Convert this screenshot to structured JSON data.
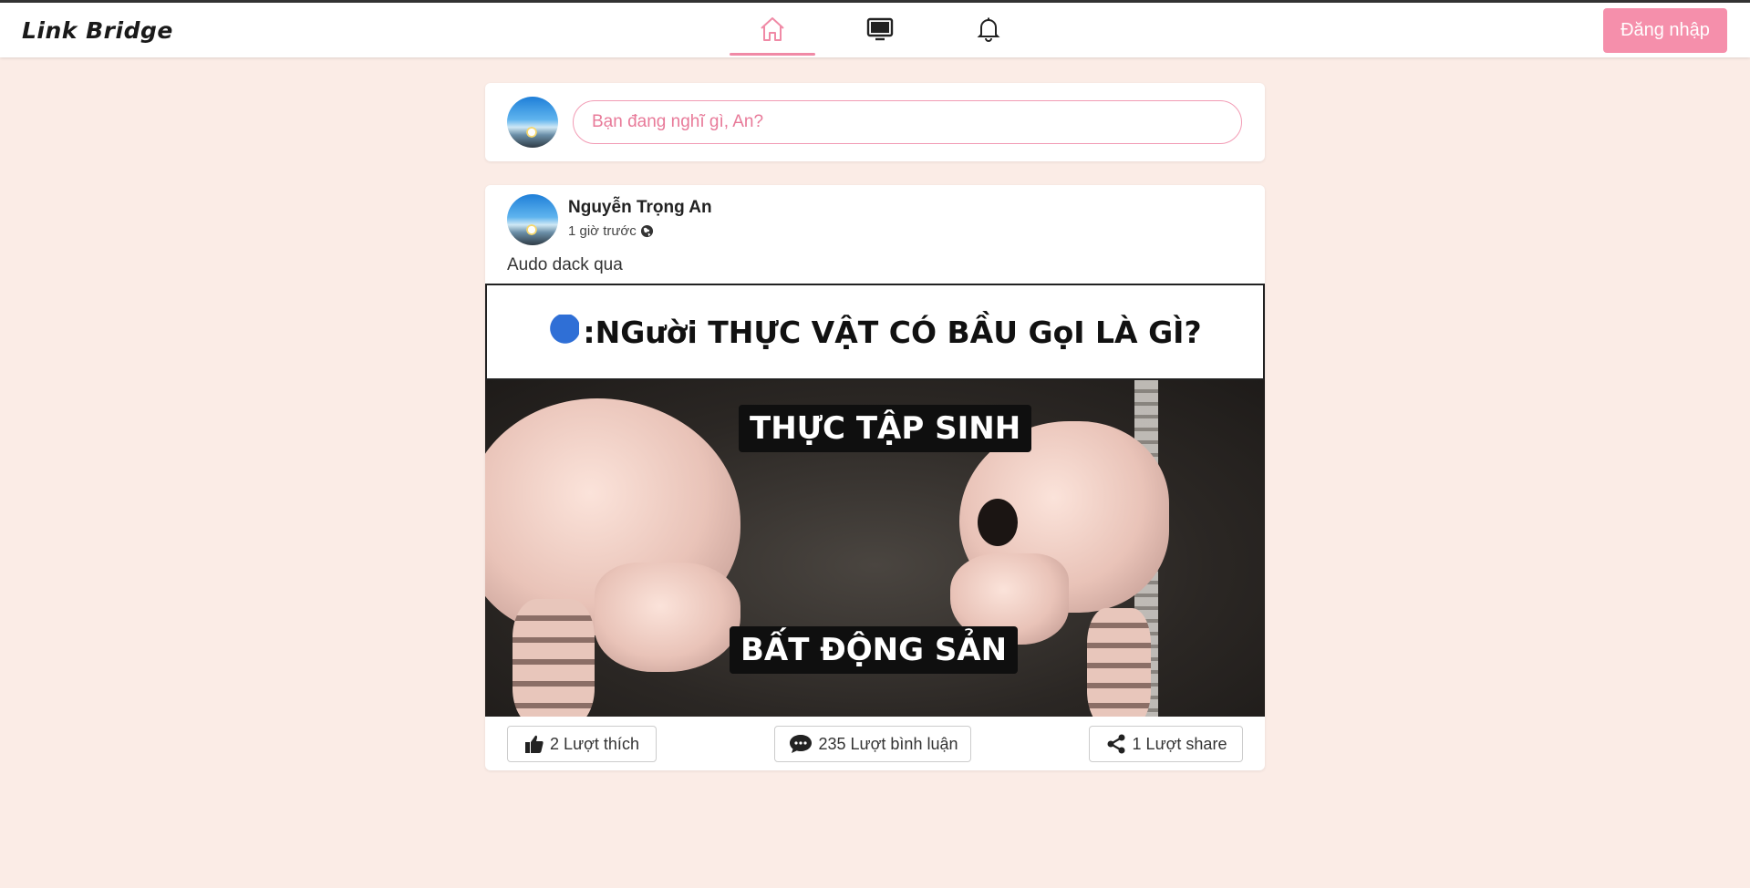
{
  "header": {
    "logo": "Link Bridge",
    "nav": [
      {
        "name": "home",
        "icon": "home-icon",
        "active": true
      },
      {
        "name": "watch",
        "icon": "tv-icon",
        "active": false
      },
      {
        "name": "notifications",
        "icon": "bell-icon",
        "active": false
      }
    ],
    "login_label": "Đăng nhập"
  },
  "composer": {
    "placeholder": "Bạn đang nghĩ gì, An?"
  },
  "post": {
    "author": "Nguyễn Trọng An",
    "time": "1 giờ trước",
    "privacy_icon": "globe-icon",
    "text": "Audo dack qua",
    "image": {
      "caption": ":NGười THỰC VẬT CÓ BẦU GọI LÀ GÌ?",
      "label_top": "THỰC TẬP SINH",
      "label_bottom": "BẤT ĐỘNG SẢN"
    },
    "actions": {
      "like": "2 Lượt thích",
      "comment": "235 Lượt bình luận",
      "share": "1 Lượt share"
    }
  },
  "colors": {
    "accent": "#f58fab",
    "background": "#fbece6"
  }
}
